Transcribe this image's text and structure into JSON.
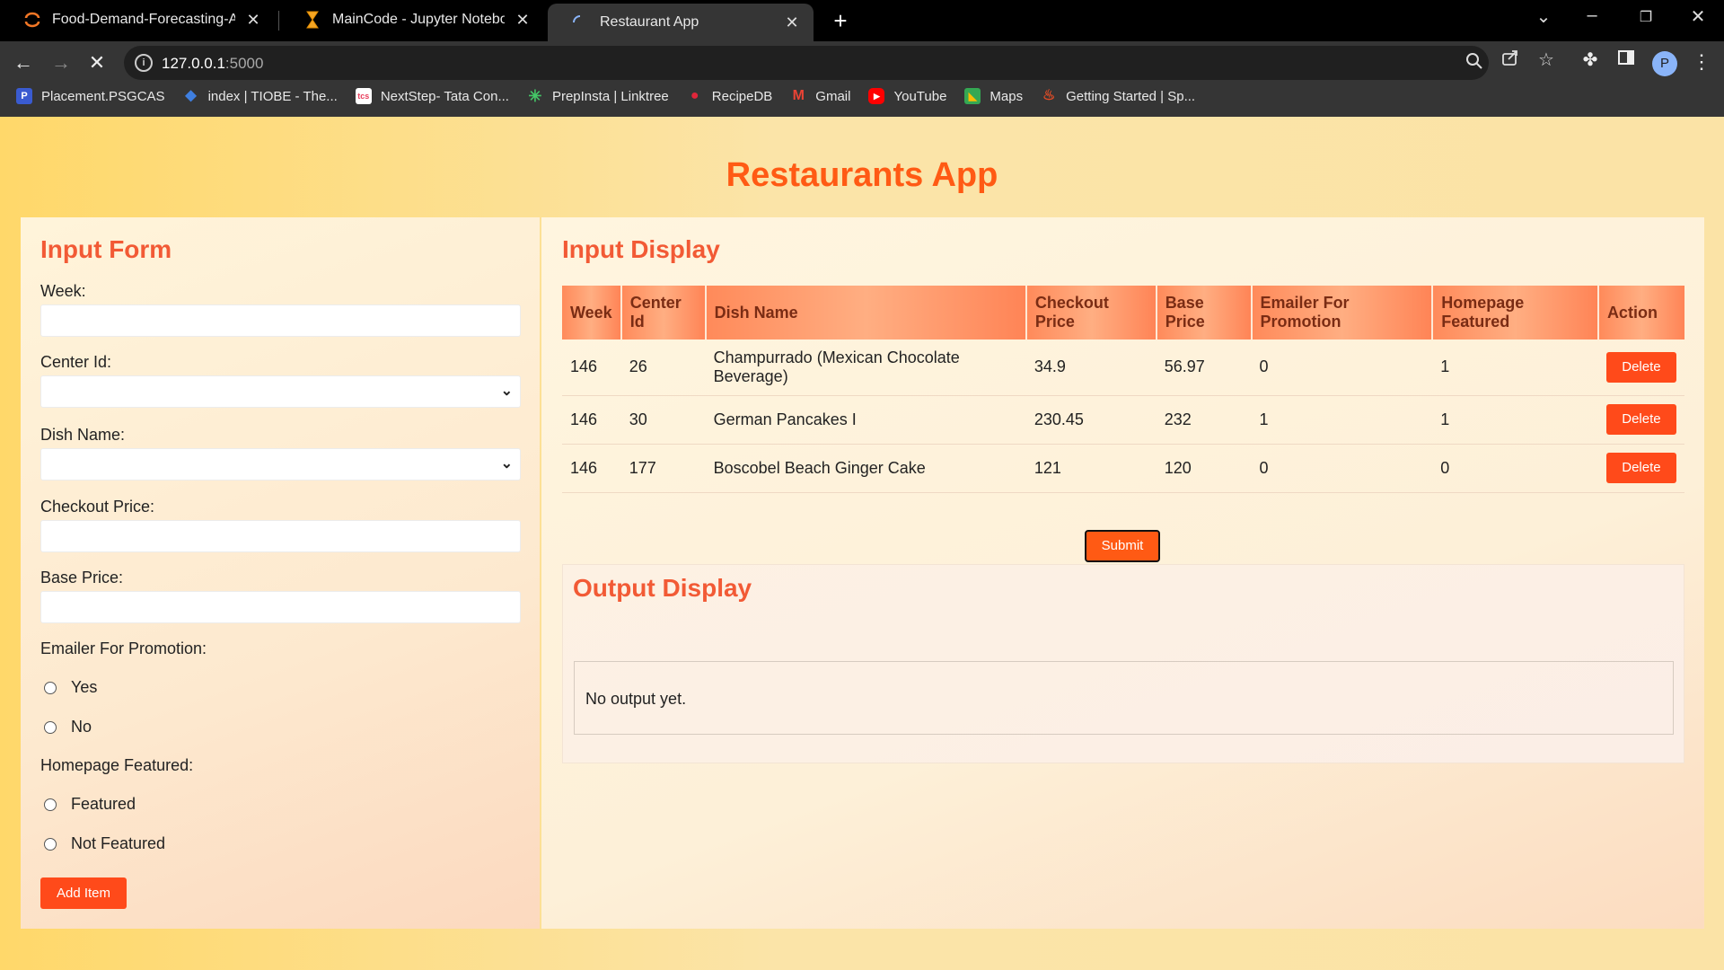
{
  "browser": {
    "tabs": [
      {
        "title": "Food-Demand-Forecasting-And-",
        "icon": "jupyter-icon",
        "active": false
      },
      {
        "title": "MainCode - Jupyter Notebook",
        "icon": "hourglass-icon",
        "active": false
      },
      {
        "title": "Restaurant App",
        "icon": "loading-icon",
        "active": true
      }
    ],
    "url_host": "127.0.0.1",
    "url_port": ":5000",
    "avatar_letter": "P",
    "bookmarks": [
      {
        "label": "Placement.PSGCAS",
        "icon": "psg-icon",
        "color": "#3a5bd0"
      },
      {
        "label": "index | TIOBE - The...",
        "icon": "tiobe-icon",
        "color": "#3f7fe0"
      },
      {
        "label": "NextStep- Tata Con...",
        "icon": "tcs-icon",
        "color": "#e83e5c"
      },
      {
        "label": "PrepInsta | Linktree",
        "icon": "linktree-icon",
        "color": "#44c767"
      },
      {
        "label": "RecipeDB",
        "icon": "recipedb-icon",
        "color": "#e0263a"
      },
      {
        "label": "Gmail",
        "icon": "gmail-icon",
        "color": "#ea4335"
      },
      {
        "label": "YouTube",
        "icon": "youtube-icon",
        "color": "#ff0000"
      },
      {
        "label": "Maps",
        "icon": "maps-icon",
        "color": "#34a853"
      },
      {
        "label": "Getting Started | Sp...",
        "icon": "spring-icon",
        "color": "#e34c26"
      }
    ]
  },
  "app": {
    "title": "Restaurants App",
    "accent": "#ff5a14"
  },
  "form": {
    "title": "Input Form",
    "week_label": "Week:",
    "center_label": "Center Id:",
    "dish_label": "Dish Name:",
    "checkout_label": "Checkout Price:",
    "base_label": "Base Price:",
    "emailer_label": "Emailer For Promotion:",
    "emailer_yes": "Yes",
    "emailer_no": "No",
    "homepage_label": "Homepage Featured:",
    "homepage_featured": "Featured",
    "homepage_not": "Not Featured",
    "add_button": "Add Item"
  },
  "display": {
    "title": "Input Display",
    "columns": [
      "Week",
      "Center Id",
      "Dish Name",
      "Checkout Price",
      "Base Price",
      "Emailer For Promotion",
      "Homepage Featured",
      "Action"
    ],
    "rows": [
      [
        "146",
        "26",
        "Champurrado (Mexican Chocolate Beverage)",
        "34.9",
        "56.97",
        "0",
        "1"
      ],
      [
        "146",
        "30",
        "German Pancakes I",
        "230.45",
        "232",
        "1",
        "1"
      ],
      [
        "146",
        "177",
        "Boscobel Beach Ginger Cake",
        "121",
        "120",
        "0",
        "0"
      ]
    ],
    "delete_label": "Delete",
    "submit_label": "Submit"
  },
  "output": {
    "title": "Output Display",
    "text": "No output yet."
  }
}
